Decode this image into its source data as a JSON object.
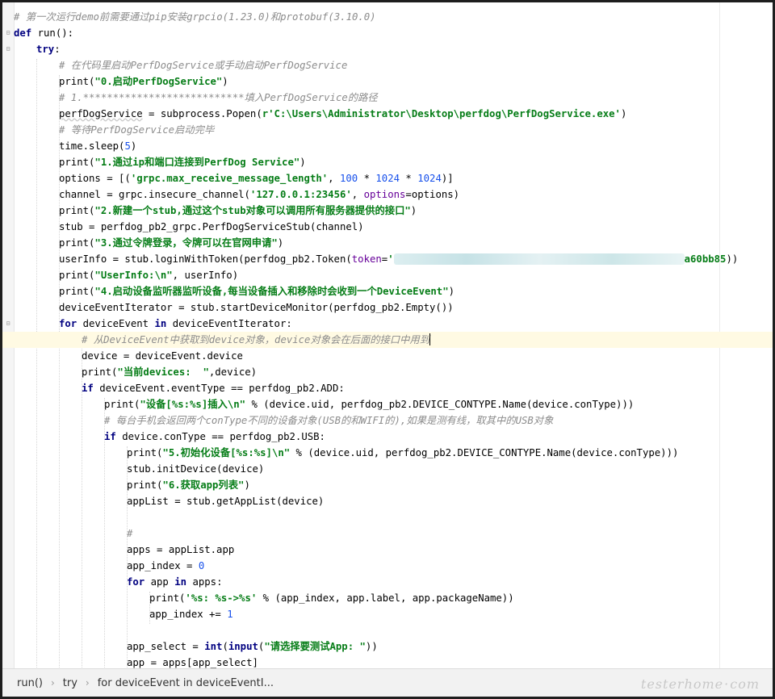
{
  "editor": {
    "lines": [
      {
        "indent": 0,
        "parts": [
          [
            "cmt",
            "# 第一次运行demo前需要通过pip安装grpcio(1.23.0)和protobuf(3.10.0)"
          ]
        ]
      },
      {
        "indent": 0,
        "parts": [
          [
            "kw",
            "def "
          ],
          [
            "",
            "run():"
          ]
        ]
      },
      {
        "indent": 1,
        "parts": [
          [
            "kw",
            "try"
          ],
          [
            "",
            ":"
          ]
        ]
      },
      {
        "indent": 2,
        "parts": [
          [
            "cmt",
            "# 在代码里启动PerfDogService或手动启动PerfDogService"
          ]
        ]
      },
      {
        "indent": 2,
        "parts": [
          [
            "",
            "print("
          ],
          [
            "str",
            "\"0.启动PerfDogService\""
          ],
          [
            "",
            ")"
          ]
        ]
      },
      {
        "indent": 2,
        "parts": [
          [
            "cmt",
            "# 1.***************************填入PerfDogService的路径"
          ]
        ]
      },
      {
        "indent": 2,
        "parts": [
          [
            "underline",
            "perfDogService"
          ],
          [
            "",
            " = subprocess.Popen("
          ],
          [
            "str",
            "r'C:\\Users\\Administrator\\Desktop\\perfdog\\PerfDogService.exe'"
          ],
          [
            "",
            ")"
          ]
        ]
      },
      {
        "indent": 2,
        "parts": [
          [
            "cmt",
            "# 等待PerfDogService启动完毕"
          ]
        ]
      },
      {
        "indent": 2,
        "parts": [
          [
            "",
            "time.sleep("
          ],
          [
            "num",
            "5"
          ],
          [
            "",
            ")"
          ]
        ]
      },
      {
        "indent": 2,
        "parts": [
          [
            "",
            "print("
          ],
          [
            "str",
            "\"1.通过ip和端口连接到PerfDog Service\""
          ],
          [
            "",
            ")"
          ]
        ]
      },
      {
        "indent": 2,
        "parts": [
          [
            "",
            "options = [("
          ],
          [
            "str",
            "'grpc.max_receive_message_length'"
          ],
          [
            "",
            ", "
          ],
          [
            "num",
            "100"
          ],
          [
            "",
            " * "
          ],
          [
            "num",
            "1024"
          ],
          [
            "",
            " * "
          ],
          [
            "num",
            "1024"
          ],
          [
            "",
            ")]"
          ]
        ]
      },
      {
        "indent": 2,
        "parts": [
          [
            "",
            "channel = grpc.insecure_channel("
          ],
          [
            "str",
            "'127.0.0.1:23456'"
          ],
          [
            "",
            ", "
          ],
          [
            "param",
            "options"
          ],
          [
            "",
            "=options)"
          ]
        ]
      },
      {
        "indent": 2,
        "parts": [
          [
            "",
            "print("
          ],
          [
            "str",
            "\"2.新建一个stub,通过这个stub对象可以调用所有服务器提供的接口\""
          ],
          [
            "",
            ")"
          ]
        ]
      },
      {
        "indent": 2,
        "parts": [
          [
            "",
            "stub = perfdog_pb2_grpc.PerfDogServiceStub(channel)"
          ]
        ]
      },
      {
        "indent": 2,
        "parts": [
          [
            "",
            "print("
          ],
          [
            "str",
            "\"3.通过令牌登录，令牌可以在官网申请\""
          ],
          [
            "",
            ")"
          ]
        ]
      },
      {
        "indent": 2,
        "parts": [
          [
            "",
            "userInfo = stub.loginWithToken(perfdog_pb2.Token("
          ],
          [
            "param",
            "token"
          ],
          [
            "",
            "="
          ],
          [
            "str",
            "'"
          ],
          [
            "blur",
            ""
          ],
          [
            "str",
            "a60bb85"
          ],
          [
            "",
            "))"
          ]
        ]
      },
      {
        "indent": 2,
        "parts": [
          [
            "",
            "print("
          ],
          [
            "str",
            "\"UserInfo:\\n\""
          ],
          [
            "",
            ", userInfo)"
          ]
        ]
      },
      {
        "indent": 2,
        "parts": [
          [
            "",
            "print("
          ],
          [
            "str",
            "\"4.启动设备监听器监听设备,每当设备插入和移除时会收到一个DeviceEvent\""
          ],
          [
            "",
            ")"
          ]
        ]
      },
      {
        "indent": 2,
        "parts": [
          [
            "",
            "deviceEventIterator = stub.startDeviceMonitor(perfdog_pb2.Empty())"
          ]
        ]
      },
      {
        "indent": 2,
        "parts": [
          [
            "kw",
            "for "
          ],
          [
            "",
            "deviceEvent "
          ],
          [
            "kw",
            "in "
          ],
          [
            "",
            "deviceEventIterator:"
          ]
        ]
      },
      {
        "indent": 3,
        "current": true,
        "parts": [
          [
            "cmt",
            "# 从DeviceEvent中获取到device对象，device对象会在后面的接口中用到"
          ],
          [
            "caret",
            ""
          ]
        ]
      },
      {
        "indent": 3,
        "parts": [
          [
            "",
            "device = deviceEvent.device"
          ]
        ]
      },
      {
        "indent": 3,
        "parts": [
          [
            "",
            "print("
          ],
          [
            "str",
            "\"当前devices:  \""
          ],
          [
            "",
            ",device)"
          ]
        ]
      },
      {
        "indent": 3,
        "parts": [
          [
            "kw",
            "if "
          ],
          [
            "",
            "deviceEvent.eventType == perfdog_pb2.ADD:"
          ]
        ]
      },
      {
        "indent": 4,
        "parts": [
          [
            "",
            "print("
          ],
          [
            "str",
            "\"设备[%s:%s]插入\\n\""
          ],
          [
            "",
            " % (device.uid, perfdog_pb2.DEVICE_CONTYPE.Name(device.conType)))"
          ]
        ]
      },
      {
        "indent": 4,
        "parts": [
          [
            "cmt",
            "# 每台手机会返回两个conType不同的设备对象(USB的和WIFI的),如果是测有线，取其中的USB对象"
          ]
        ]
      },
      {
        "indent": 4,
        "parts": [
          [
            "kw",
            "if "
          ],
          [
            "",
            "device.conType == perfdog_pb2.USB:"
          ]
        ]
      },
      {
        "indent": 5,
        "parts": [
          [
            "",
            "print("
          ],
          [
            "str",
            "\"5.初始化设备[%s:%s]\\n\""
          ],
          [
            "",
            " % (device.uid, perfdog_pb2.DEVICE_CONTYPE.Name(device.conType)))"
          ]
        ]
      },
      {
        "indent": 5,
        "parts": [
          [
            "",
            "stub.initDevice(device)"
          ]
        ]
      },
      {
        "indent": 5,
        "parts": [
          [
            "",
            "print("
          ],
          [
            "str",
            "\"6.获取app列表\""
          ],
          [
            "",
            ")"
          ]
        ]
      },
      {
        "indent": 5,
        "parts": [
          [
            "",
            "appList = stub.getAppList(device)"
          ]
        ]
      },
      {
        "indent": 5,
        "parts": []
      },
      {
        "indent": 5,
        "parts": [
          [
            "cmt",
            "#"
          ]
        ]
      },
      {
        "indent": 5,
        "parts": [
          [
            "",
            "apps = appList.app"
          ]
        ]
      },
      {
        "indent": 5,
        "parts": [
          [
            "",
            "app_index = "
          ],
          [
            "num",
            "0"
          ]
        ]
      },
      {
        "indent": 5,
        "parts": [
          [
            "kw",
            "for "
          ],
          [
            "",
            "app "
          ],
          [
            "kw",
            "in "
          ],
          [
            "",
            "apps:"
          ]
        ]
      },
      {
        "indent": 6,
        "parts": [
          [
            "",
            "print("
          ],
          [
            "str",
            "'%s: %s->%s'"
          ],
          [
            "",
            " % (app_index, app.label, app.packageName))"
          ]
        ]
      },
      {
        "indent": 6,
        "parts": [
          [
            "",
            "app_index += "
          ],
          [
            "num",
            "1"
          ]
        ]
      },
      {
        "indent": 5,
        "parts": []
      },
      {
        "indent": 5,
        "parts": [
          [
            "",
            "app_select = "
          ],
          [
            "kw",
            "int"
          ],
          [
            "",
            "("
          ],
          [
            "kw",
            "input"
          ],
          [
            "",
            "("
          ],
          [
            "str",
            "\"请选择要测试App: \""
          ],
          [
            "",
            "))"
          ]
        ]
      },
      {
        "indent": 5,
        "parts": [
          [
            "",
            "app = apps[app_select]"
          ]
        ]
      }
    ]
  },
  "breadcrumb": {
    "items": [
      "run()",
      "try",
      "for deviceEvent in deviceEventI..."
    ]
  },
  "watermark": {
    "text_a": "tester",
    "text_b": "home",
    "text_c": "com"
  }
}
